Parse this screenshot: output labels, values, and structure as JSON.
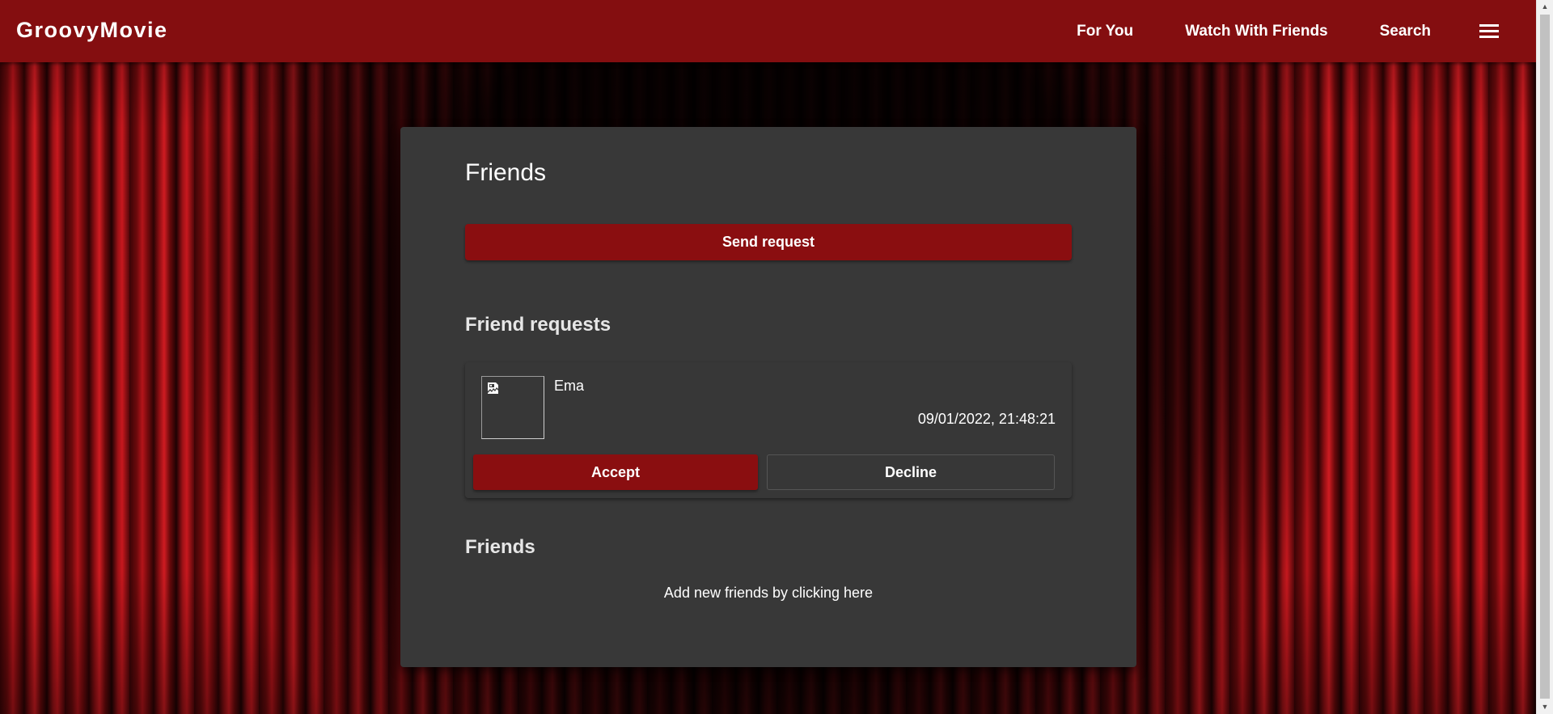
{
  "navbar": {
    "brand": "GroovyMovie",
    "links": [
      "For You",
      "Watch With Friends",
      "Search"
    ],
    "menu_icon": "hamburger-menu-icon"
  },
  "page": {
    "title": "Friends",
    "send_request_label": "Send request",
    "requests_title": "Friend requests",
    "requests": [
      {
        "name": "Ema",
        "timestamp": "09/01/2022, 21:48:21",
        "avatar_icon": "broken-image-icon",
        "accept_label": "Accept",
        "decline_label": "Decline"
      }
    ],
    "friends_title": "Friends",
    "friends_empty_text": "Add new friends by clicking here"
  },
  "colors": {
    "navbar": "#840e10",
    "accent": "#8a0e10",
    "card": "#383838"
  }
}
